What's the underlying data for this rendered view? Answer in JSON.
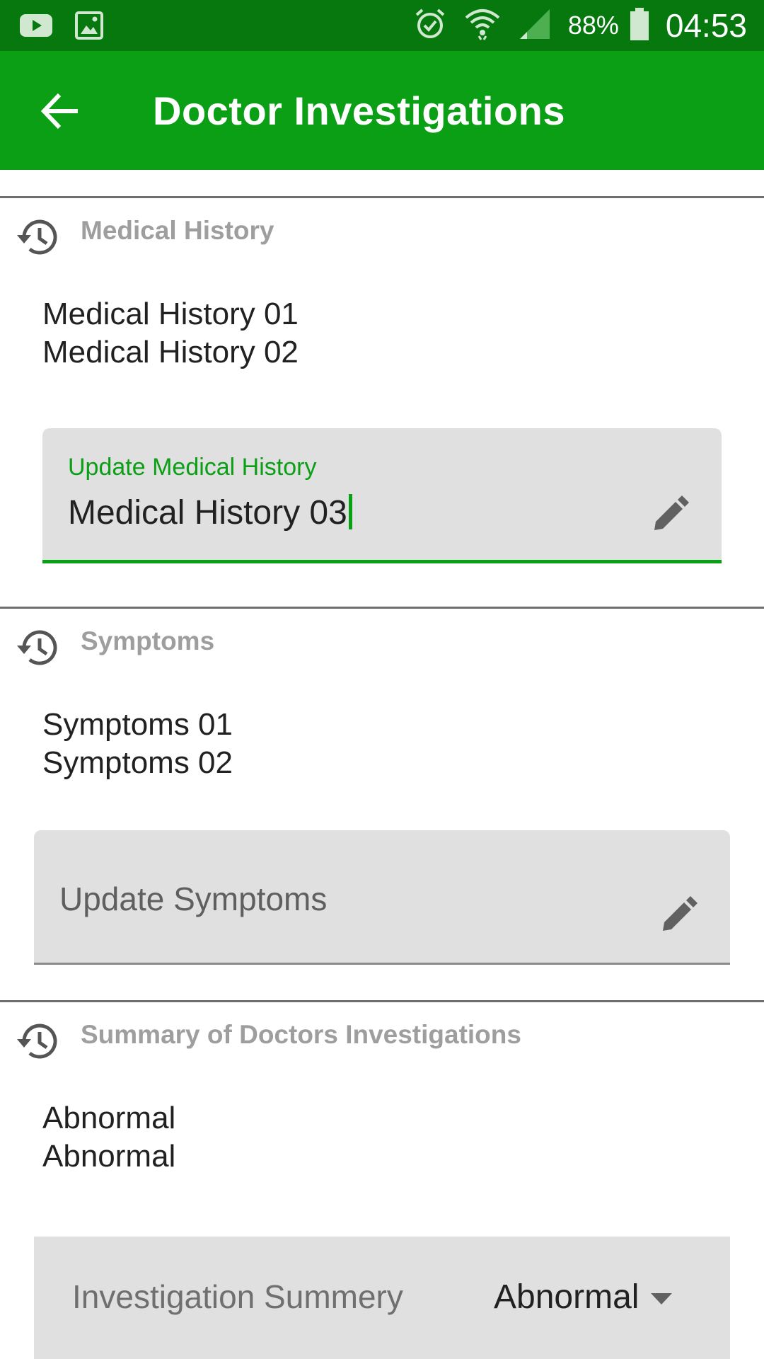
{
  "status_bar": {
    "battery_percent": "88%",
    "time": "04:53",
    "left_icons": [
      "youtube-icon",
      "image-icon"
    ],
    "right_icons": [
      "alarm-icon",
      "wifi-icon",
      "signal-icon",
      "battery-icon"
    ]
  },
  "app_bar": {
    "title": "Doctor Investigations",
    "back_icon": "arrow-back-icon",
    "color": "#0b9f16"
  },
  "sections": {
    "medical_history": {
      "title": "Medical History",
      "icon": "history-icon",
      "entries": [
        "Medical History 01",
        "Medical History 02"
      ],
      "input": {
        "label": "Update Medical History",
        "value": "Medical History 03",
        "focused": true,
        "icon": "pencil-icon"
      }
    },
    "symptoms": {
      "title": "Symptoms",
      "icon": "history-icon",
      "entries": [
        "Symptoms 01",
        "Symptoms 02"
      ],
      "input": {
        "placeholder": "Update Symptoms",
        "value": "",
        "focused": false,
        "icon": "pencil-icon"
      }
    },
    "summary": {
      "title": "Summary of Doctors Investigations",
      "icon": "history-icon",
      "entries": [
        "Abnormal",
        "Abnormal"
      ],
      "select": {
        "label": "Investigation Summery",
        "selected": "Abnormal",
        "icon": "dropdown-arrow-icon"
      }
    }
  },
  "colors": {
    "status_bar": "#06780e",
    "accent": "#0b9f16",
    "section_title": "#9e9e9e",
    "field_bg": "#e0e0e0"
  }
}
